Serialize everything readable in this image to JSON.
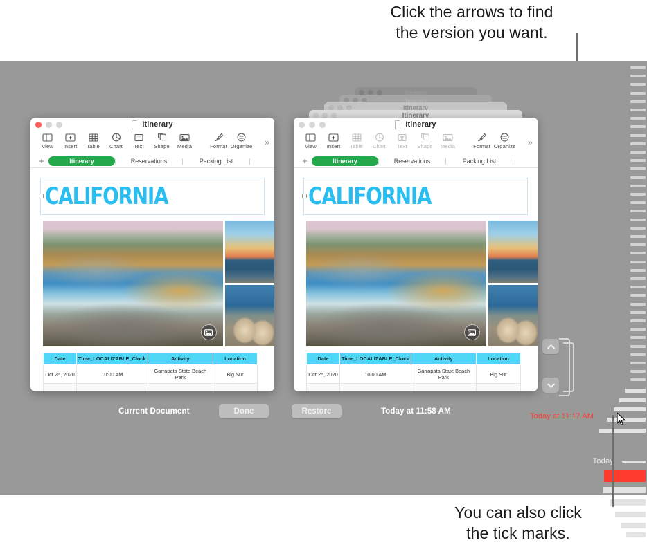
{
  "callouts": {
    "top": "Click the arrows to find\nthe version you want.",
    "bottom": "You can also click\nthe tick marks."
  },
  "colors": {
    "backdrop": "#999999",
    "accent_green": "#23a94b",
    "title_cyan": "#29bdf0",
    "table_header": "#4ed6f5",
    "selected_red": "#ff3b30",
    "traffic_red": "#ff5f57"
  },
  "document": {
    "title": "Itinerary",
    "toolbar": [
      {
        "label": "View",
        "icon": "sidebar-icon"
      },
      {
        "label": "Insert",
        "icon": "insert-plus-icon"
      },
      {
        "label": "Table",
        "icon": "table-icon"
      },
      {
        "label": "Chart",
        "icon": "chart-icon"
      },
      {
        "label": "Text",
        "icon": "text-box-icon"
      },
      {
        "label": "Shape",
        "icon": "shape-icon"
      },
      {
        "label": "Media",
        "icon": "media-icon"
      },
      {
        "label": "Format",
        "icon": "format-brush-icon"
      },
      {
        "label": "Organize",
        "icon": "organize-icon"
      }
    ],
    "more_tools": "»",
    "add_tab": "+",
    "tabs": [
      {
        "label": "Itinerary",
        "active": true
      },
      {
        "label": "Reservations",
        "active": false
      },
      {
        "label": "Packing List",
        "active": false
      }
    ],
    "heading": "CALIFORNIA",
    "media_badge": "media-placeholder-icon",
    "table": {
      "headers": [
        "Date",
        "Time_LOCALIZABLE_Clock",
        "Activity",
        "Location"
      ],
      "rows": [
        [
          "Oct 25, 2020",
          "10:00 AM",
          "Garrapata State Beach Park",
          "Big Sur"
        ]
      ]
    }
  },
  "version_browser": {
    "current_document_label": "Current Document",
    "done_button": "Done",
    "restore_button": "Restore",
    "selected_version_date": "Today at 11:58 AM",
    "hovered_version_date": "Today at 11:17 AM",
    "timeline_today_label": "Today",
    "arrow_up": "chevron-up-icon",
    "arrow_down": "chevron-down-icon",
    "stacked_window_titles": [
      "Itinerary",
      "Itinerary",
      "Itinerary",
      "Itinerary",
      "Itinerary"
    ]
  }
}
